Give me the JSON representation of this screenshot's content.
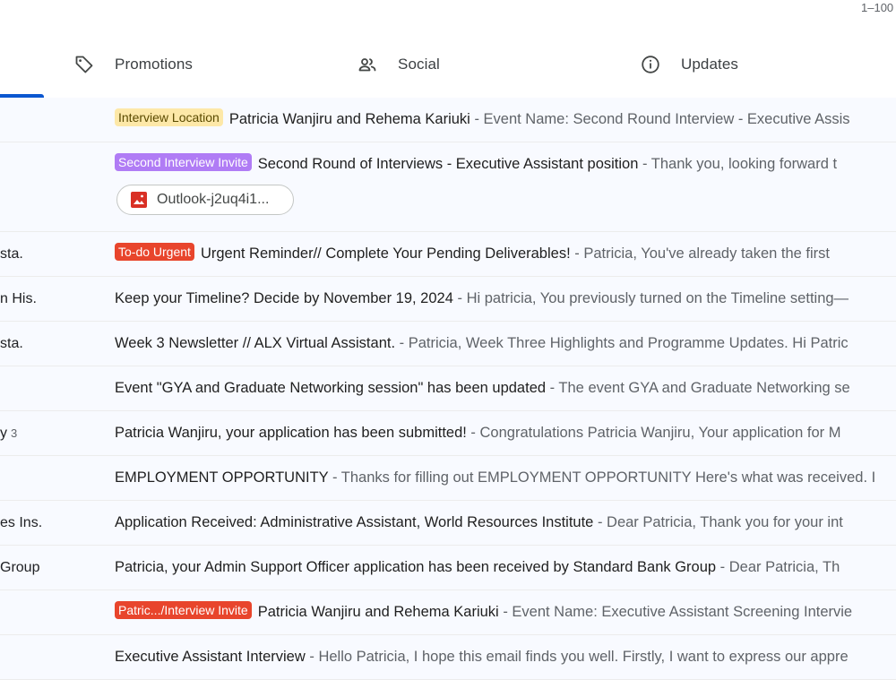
{
  "pager": {
    "range": "1–100"
  },
  "tabs": [
    {
      "label": "Promotions",
      "icon": "tag-icon"
    },
    {
      "label": "Social",
      "icon": "people-icon"
    },
    {
      "label": "Updates",
      "icon": "info-icon"
    }
  ],
  "colors": {
    "accent": "#0b57d0",
    "label_interview_location_bg": "#fde8a8",
    "label_second_interview_bg": "#b07cf5",
    "label_todo_urgent_bg": "#e8452c",
    "label_patric_interview_bg": "#e8452c"
  },
  "emails": [
    {
      "sender": "",
      "label": "Interview Location",
      "subject": "Patricia Wanjiru and Rehema Kariuki",
      "snippet": "Event Name: Second Round Interview - Executive Assis"
    },
    {
      "sender": "",
      "label": "Second Interview Invite",
      "subject": "Second Round of Interviews - Executive Assistant position",
      "snippet": "Thank you, looking forward t",
      "attachment": "Outlook-j2uq4i1..."
    },
    {
      "sender": "sta.",
      "label": "To-do Urgent",
      "subject": "Urgent Reminder// Complete Your Pending  Deliverables!",
      "snippet": "Patricia, You've already taken the first"
    },
    {
      "sender": "n His.",
      "subject": "Keep your Timeline? Decide by November 19, 2024",
      "snippet": "Hi patricia, You previously turned on the Timeline setting—"
    },
    {
      "sender": "sta.",
      "subject": "Week 3 Newsletter // ALX Virtual Assistant.",
      "snippet": "Patricia, Week Three Highlights and Programme Updates. Hi Patric"
    },
    {
      "sender": "",
      "subject": "Event \"GYA and Graduate Networking session\" has been updated",
      "snippet": "The event GYA and Graduate Networking se"
    },
    {
      "sender": "y",
      "count": "3",
      "subject": "Patricia Wanjiru, your application has been submitted!",
      "snippet": "Congratulations Patricia Wanjiru, Your application for M"
    },
    {
      "sender": "",
      "subject": "EMPLOYMENT OPPORTUNITY",
      "snippet": "Thanks for filling out EMPLOYMENT OPPORTUNITY Here's what was received. I"
    },
    {
      "sender": "es Ins.",
      "subject": "Application Received: Administrative Assistant, World Resources Institute",
      "snippet": "Dear Patricia, Thank you for your int"
    },
    {
      "sender": "Group",
      "subject": "Patricia, your Admin Support Officer application has been received by Standard Bank Group",
      "snippet": "Dear Patricia, Th"
    },
    {
      "sender": "",
      "label": "Patric.../Interview Invite",
      "subject": "Patricia Wanjiru and Rehema Kariuki",
      "snippet": "Event Name: Executive Assistant Screening Intervie"
    },
    {
      "sender": "",
      "subject": "Executive Assistant Interview",
      "snippet": "Hello Patricia, I hope this email finds you well. Firstly, I want to express our appre"
    }
  ],
  "separator": " - "
}
